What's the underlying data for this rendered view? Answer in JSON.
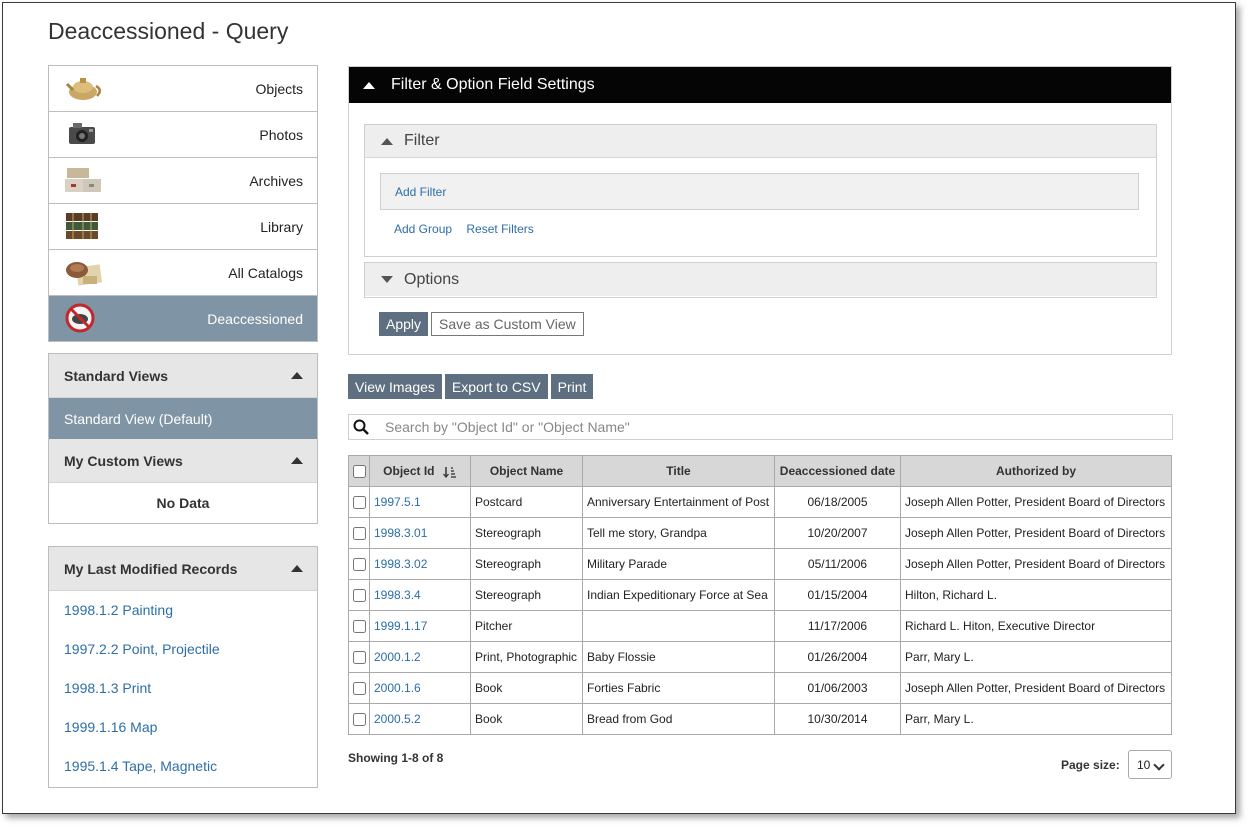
{
  "page_title": "Deaccessioned - Query",
  "catalogs": [
    {
      "label": "Objects",
      "icon": "teapot-icon"
    },
    {
      "label": "Photos",
      "icon": "camera-icon"
    },
    {
      "label": "Archives",
      "icon": "boxes-icon"
    },
    {
      "label": "Library",
      "icon": "books-icon"
    },
    {
      "label": "All Catalogs",
      "icon": "collection-icon"
    },
    {
      "label": "Deaccessioned",
      "icon": "deaccessioned-icon"
    }
  ],
  "views": {
    "standard_header": "Standard Views",
    "standard_active": "Standard View (Default)",
    "custom_header": "My Custom Views",
    "custom_empty": "No Data"
  },
  "last_modified": {
    "header": "My Last Modified Records",
    "items": [
      "1998.1.2 Painting",
      "1997.2.2 Point, Projectile",
      "1998.1.3 Print",
      "1999.1.16 Map",
      "1995.1.4 Tape, Magnetic"
    ]
  },
  "filter_panel": {
    "title": "Filter & Option Field Settings",
    "filter_label": "Filter",
    "add_filter": "Add Filter",
    "add_group": "Add Group",
    "reset_filters": "Reset Filters",
    "options_label": "Options",
    "apply": "Apply",
    "save_custom": "Save as Custom View"
  },
  "actions": {
    "view_images": "View Images",
    "export_csv": "Export to CSV",
    "print": "Print"
  },
  "search": {
    "placeholder": "Search by \"Object Id\" or \"Object Name\""
  },
  "table": {
    "columns": [
      "Object Id",
      "Object Name",
      "Title",
      "Deaccessioned date",
      "Authorized by"
    ],
    "rows": [
      {
        "id": "1997.5.1",
        "name": "Postcard",
        "title": "Anniversary Entertainment of Post",
        "date": "06/18/2005",
        "auth": "Joseph Allen Potter, President Board of Directors"
      },
      {
        "id": "1998.3.01",
        "name": "Stereograph",
        "title": "Tell me story, Grandpa",
        "date": "10/20/2007",
        "auth": "Joseph Allen Potter, President Board of Directors"
      },
      {
        "id": "1998.3.02",
        "name": "Stereograph",
        "title": "Military Parade",
        "date": "05/11/2006",
        "auth": "Joseph Allen Potter, President Board of Directors"
      },
      {
        "id": "1998.3.4",
        "name": "Stereograph",
        "title": "Indian Expeditionary Force at Sea",
        "date": "01/15/2004",
        "auth": "Hilton, Richard L."
      },
      {
        "id": "1999.1.17",
        "name": "Pitcher",
        "title": "",
        "date": "11/17/2006",
        "auth": "Richard L. Hiton, Executive Director"
      },
      {
        "id": "2000.1.2",
        "name": "Print, Photographic",
        "title": "Baby Flossie",
        "date": "01/26/2004",
        "auth": "Parr, Mary L."
      },
      {
        "id": "2000.1.6",
        "name": "Book",
        "title": "Forties Fabric",
        "date": "01/06/2003",
        "auth": "Joseph Allen Potter, President Board of Directors"
      },
      {
        "id": "2000.5.2",
        "name": "Book",
        "title": "Bread from God",
        "date": "10/30/2014",
        "auth": "Parr, Mary L."
      }
    ]
  },
  "footer": {
    "showing": "Showing 1-8 of 8",
    "page_size_label": "Page size:",
    "page_size_value": "10"
  }
}
